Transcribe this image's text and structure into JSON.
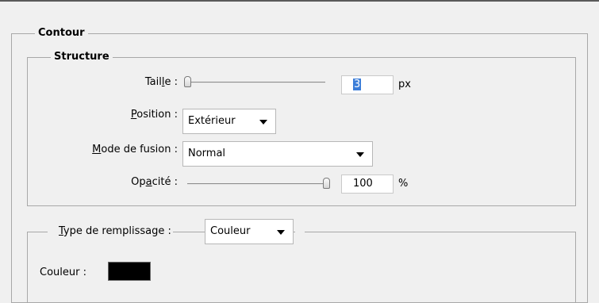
{
  "contour": {
    "title": "Contour"
  },
  "structure": {
    "title": "Structure",
    "taille": {
      "label_pre": "Tail",
      "label_u": "l",
      "label_post": "e :",
      "value": "3",
      "unit": "px",
      "slider": 0.0
    },
    "position": {
      "label_u": "P",
      "label_post": "osition :",
      "value": "Extérieur"
    },
    "mode": {
      "label_u": "M",
      "label_post": "ode de fusion :",
      "value": "Normal"
    },
    "opacite": {
      "label_pre": "Op",
      "label_u": "a",
      "label_post": "cité :",
      "value": "100",
      "unit": "%",
      "slider": 1.0
    }
  },
  "remplissage": {
    "type_label_u": "T",
    "type_label_post": "ype de remplissage :",
    "type_value": "Couleur",
    "couleur_label": "Couleur :",
    "couleur_value": "#000000"
  }
}
